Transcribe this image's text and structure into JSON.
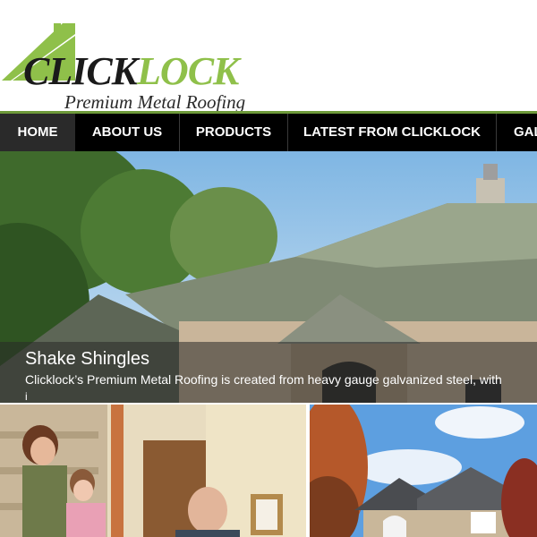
{
  "brand": {
    "name_part1": "CLICK",
    "name_part2": "LOCK",
    "tagline": "Premium Metal Roofing"
  },
  "nav": {
    "items": [
      {
        "label": "HOME",
        "active": true
      },
      {
        "label": "ABOUT US",
        "active": false
      },
      {
        "label": "PRODUCTS",
        "active": false
      },
      {
        "label": "LATEST FROM CLICKLOCK",
        "active": false
      },
      {
        "label": "GAL",
        "active": false
      }
    ]
  },
  "hero": {
    "title": "Shake Shingles",
    "text": "Clicklock’s Premium Metal Roofing is created from heavy gauge galvanized steel, with",
    "more": "i"
  },
  "colors": {
    "brand_green": "#8fc04a",
    "nav_border_green": "#6e9a3a",
    "nav_bg": "#000000",
    "nav_active_bg": "#2a2a2a"
  }
}
